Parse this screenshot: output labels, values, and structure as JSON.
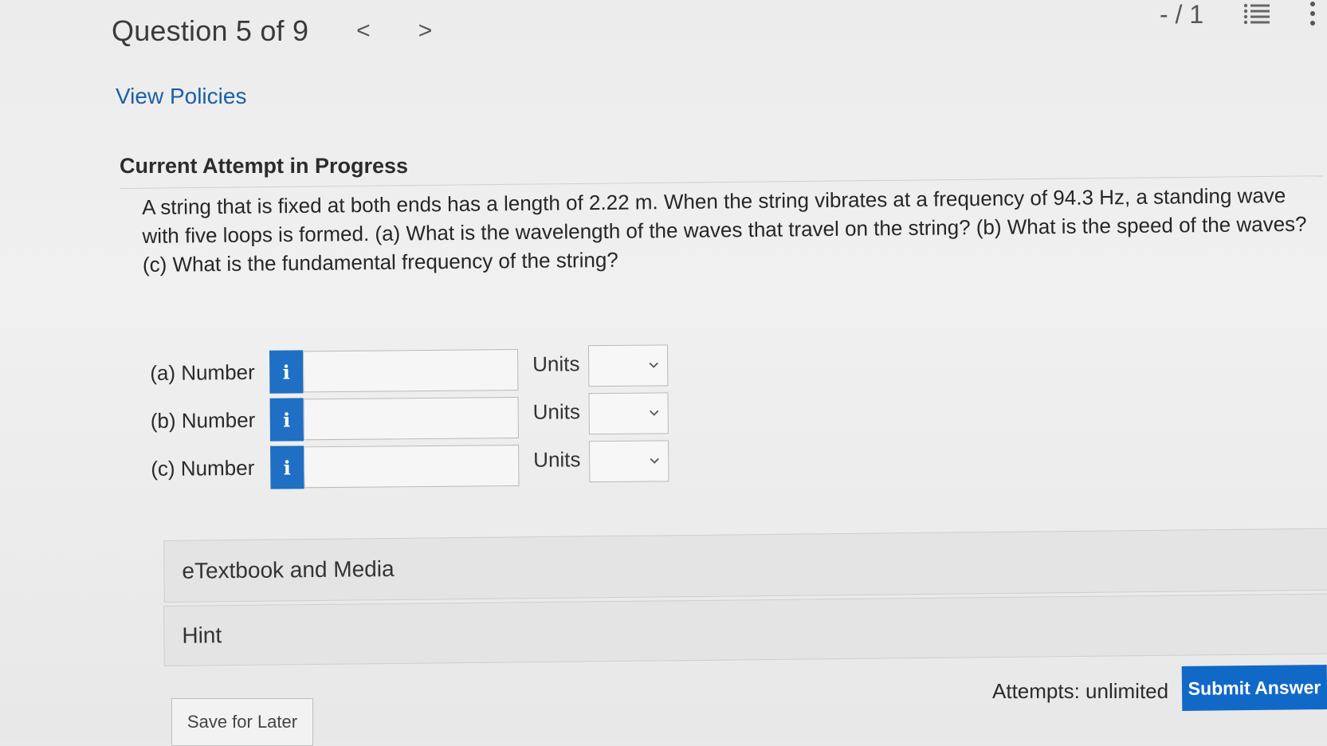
{
  "header": {
    "question_label": "Question 5 of 9",
    "prev_glyph": "<",
    "next_glyph": ">",
    "score": "- / 1"
  },
  "links": {
    "view_policies": "View Policies"
  },
  "attempt": {
    "title": "Current Attempt in Progress"
  },
  "question": {
    "text": "A string that is fixed at both ends has a length of 2.22 m. When the string vibrates at a frequency of 94.3 Hz, a standing wave with five loops is formed. (a) What is the wavelength of the waves that travel on the string? (b) What is the speed of the waves? (c) What is the fundamental frequency of the string?"
  },
  "answers": [
    {
      "label": "(a) Number",
      "info": "i",
      "value": "",
      "units_label": "Units",
      "units_value": ""
    },
    {
      "label": "(b) Number",
      "info": "i",
      "value": "",
      "units_label": "Units",
      "units_value": ""
    },
    {
      "label": "(c) Number",
      "info": "i",
      "value": "",
      "units_label": "Units",
      "units_value": ""
    }
  ],
  "panels": {
    "etextbook": "eTextbook and Media",
    "hint": "Hint"
  },
  "footer": {
    "save_label": "Save for Later",
    "attempts": "Attempts: unlimited",
    "submit_label": "Submit Answer"
  },
  "colors": {
    "accent": "#1169c7",
    "link": "#1a5fa8",
    "info_button": "#1f6fc4"
  },
  "icons": {
    "list": "list-icon",
    "more": "more-vertical-icon",
    "chevron": "chevron-down-icon"
  }
}
